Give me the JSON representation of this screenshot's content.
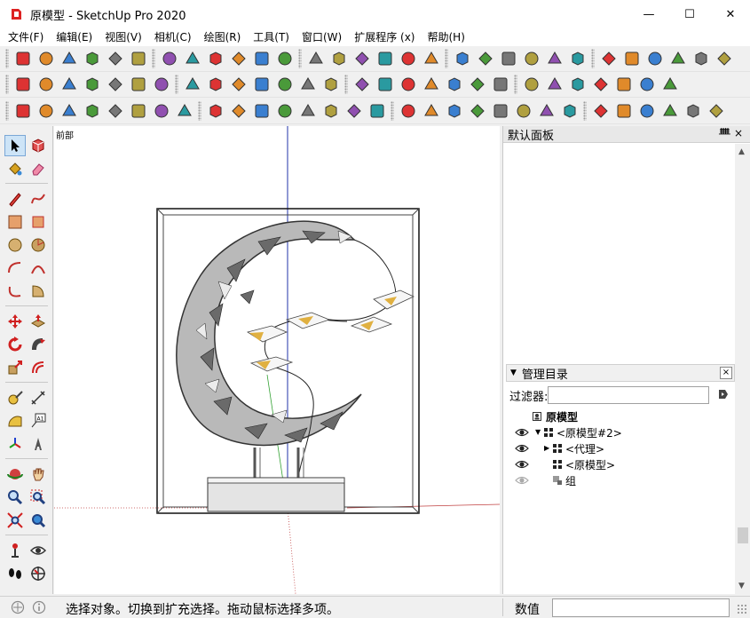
{
  "window": {
    "title": "原模型 - SketchUp Pro 2020",
    "minimize_glyph": "—",
    "maximize_glyph": "☐",
    "close_glyph": "✕"
  },
  "menu": [
    {
      "label": "文件(F)"
    },
    {
      "label": "编辑(E)"
    },
    {
      "label": "视图(V)"
    },
    {
      "label": "相机(C)"
    },
    {
      "label": "绘图(R)"
    },
    {
      "label": "工具(T)"
    },
    {
      "label": "窗口(W)"
    },
    {
      "label": "扩展程序 (x)"
    },
    {
      "label": "帮助(H)"
    }
  ],
  "toolbar_icons": {
    "row1": [
      "get-models-icon",
      "share-model-icon",
      "house-dark-icon",
      "house-icon",
      "house-outline-icon",
      "warehouse-icon",
      "check-circle-icon",
      "teapot-icon",
      "cloud-hand-icon",
      "cloud-icon",
      "sandbox-icon",
      "terrain-icon",
      "window-icon",
      "window-lock-icon",
      "window-image-icon",
      "padlock-icon",
      "funnel-icon",
      "ring-icon",
      "protractor-icon",
      "stool-icon",
      "sun-icon",
      "dome-icon",
      "cube-outline-icon",
      "globe-sphere-icon",
      "layers-icon",
      "diagonal-box-icon",
      "wire-cube-icon",
      "wire-cube-2-icon",
      "gear-ring-icon",
      "grid-box-icon"
    ],
    "row2": [
      "ruby-gem-icon",
      "ruby-gem-2-icon",
      "red-swirl-icon",
      "red-swirl-2-icon",
      "bulb-icon",
      "rbc-icon",
      "red-shield-icon",
      "camera-walk-icon",
      "box-open-icon",
      "box-dark-icon",
      "hand-select-icon",
      "pencil-box-icon",
      "solid-box-icon",
      "solid-box-light-icon",
      "box-wire-icon",
      "box-flat-icon",
      "box-shade-icon",
      "stack-icon",
      "material-icon",
      "axis-x-icon",
      "axis-y-icon",
      "axis-z-icon",
      "axis-v-icon",
      "axis-r-icon",
      "guide-icon",
      "guide-2-icon",
      "move-cross-icon",
      "monitor-red-icon"
    ],
    "row3": [
      "render-a-icon",
      "render-b-icon",
      "exe-icon",
      "web-icon",
      "nav-a-icon",
      "nav-b-icon",
      "nav-c-icon",
      "nav-d-icon",
      "nav-e-icon",
      "nav-f-icon",
      "nav-g-icon",
      "globe-icon",
      "shield-gold-icon",
      "sync-icon",
      "car-icon",
      "projector-icon",
      "camera-box-icon",
      "car-dark-icon",
      "shield-plant-icon",
      "tree-icon",
      "gear-box-icon",
      "speaker-icon",
      "sliders-icon",
      "sliders-2-icon",
      "speech-icon",
      "info-icon",
      "red-hex-icon",
      "red-cross-icon",
      "red-shield-2-icon",
      "red-drop-icon"
    ]
  },
  "viewport": {
    "scene_label": "前部"
  },
  "default_tray": {
    "title": "默认面板",
    "pin_glyph": "ᚙ",
    "close_glyph": "×"
  },
  "outliner": {
    "title": "管理目录",
    "toggle_glyph": "▼",
    "close_glyph": "×",
    "filter_label": "过滤器:",
    "filter_value": "",
    "root_label": "原模型",
    "rows": [
      {
        "label": "<原模型#2>",
        "twisty": "▼"
      },
      {
        "label": "<代理>",
        "twisty": "▶"
      },
      {
        "label": "<原模型>",
        "twisty": ""
      },
      {
        "label": "组",
        "twisty": ""
      }
    ]
  },
  "status": {
    "text": "选择对象。切换到扩充选择。拖动鼠标选择多项。",
    "measurement_label": "数值",
    "measurement_value": ""
  }
}
